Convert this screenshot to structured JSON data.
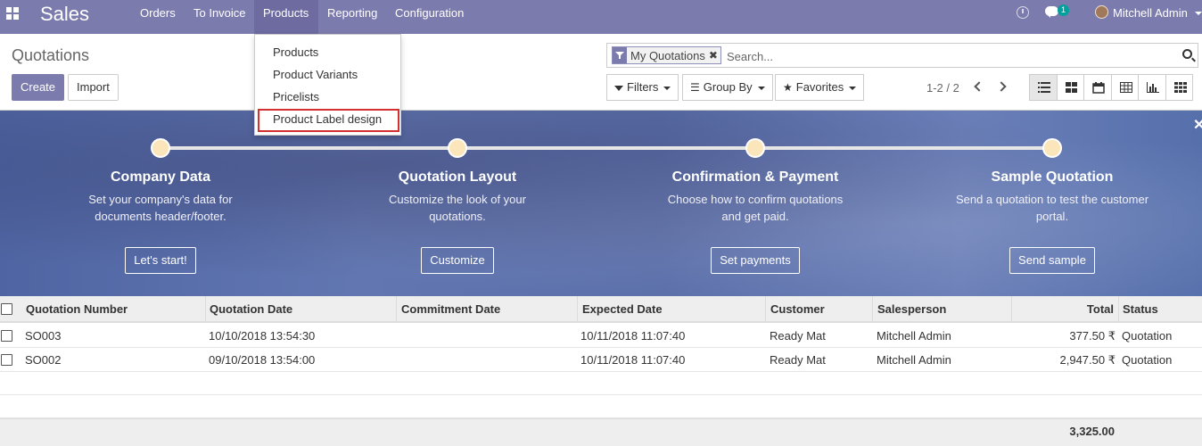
{
  "app": {
    "brand": "Sales"
  },
  "menu": {
    "orders": "Orders",
    "to_invoice": "To Invoice",
    "products": "Products",
    "reporting": "Reporting",
    "configuration": "Configuration"
  },
  "topbar": {
    "chat_count": "1",
    "user_name": "Mitchell Admin"
  },
  "products_menu": {
    "items": [
      "Products",
      "Product Variants",
      "Pricelists",
      "Product Label design"
    ]
  },
  "control": {
    "breadcrumb": "Quotations",
    "create_label": "Create",
    "import_label": "Import",
    "facet_label": "My Quotations",
    "search_placeholder": "Search...",
    "filters_label": "Filters",
    "groupby_label": "Group By",
    "favorites_label": "Favorites",
    "pager": "1-2 / 2"
  },
  "banner": {
    "steps": [
      {
        "title": "Company Data",
        "desc": "Set your company's data for documents header/footer.",
        "button": "Let's start!"
      },
      {
        "title": "Quotation Layout",
        "desc": "Customize the look of your quotations.",
        "button": "Customize"
      },
      {
        "title": "Confirmation & Payment",
        "desc": "Choose how to confirm quotations and get paid.",
        "button": "Set payments"
      },
      {
        "title": "Sample Quotation",
        "desc": "Send a quotation to test the customer portal.",
        "button": "Send sample"
      }
    ]
  },
  "table": {
    "columns": [
      "Quotation Number",
      "Quotation Date",
      "Commitment Date",
      "Expected Date",
      "Customer",
      "Salesperson",
      "Total",
      "Status"
    ],
    "rows": [
      {
        "number": "SO003",
        "date": "10/10/2018 13:54:30",
        "commitment": "",
        "expected": "10/11/2018 11:07:40",
        "customer": "Ready Mat",
        "salesperson": "Mitchell Admin",
        "total": "377.50 ₹",
        "status": "Quotation"
      },
      {
        "number": "SO002",
        "date": "09/10/2018 13:54:00",
        "commitment": "",
        "expected": "10/11/2018 11:07:40",
        "customer": "Ready Mat",
        "salesperson": "Mitchell Admin",
        "total": "2,947.50 ₹",
        "status": "Quotation"
      }
    ],
    "sum_total": "3,325.00"
  },
  "colors": {
    "navbar": "#7c7bad",
    "primary": "#7c7bad",
    "highlight": "#d32f2f"
  }
}
